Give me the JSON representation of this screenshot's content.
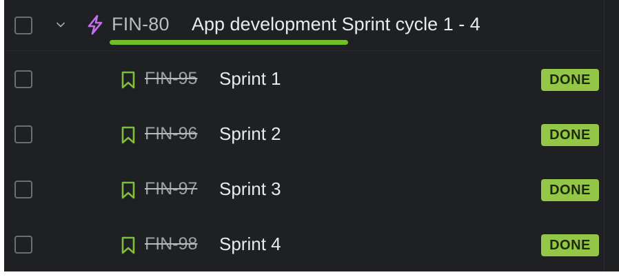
{
  "colors": {
    "background": "#1e1f21",
    "selected_row": "#1a2a45",
    "epic_icon": "#c370f0",
    "story_icon": "#7fbf3a",
    "progress": "#70bf28",
    "done_badge": "#94c748"
  },
  "parent": {
    "icon": "lightning-bolt-icon",
    "key": "FIN-80",
    "title": "App development Sprint cycle 1 - 4",
    "progress_done_fraction": 1.0
  },
  "children": [
    {
      "key": "FIN-95",
      "title": "Sprint 1",
      "status": "DONE",
      "icon": "bookmark-icon",
      "selected": true
    },
    {
      "key": "FIN-96",
      "title": "Sprint 2",
      "status": "DONE",
      "icon": "bookmark-icon",
      "selected": false
    },
    {
      "key": "FIN-97",
      "title": "Sprint 3",
      "status": "DONE",
      "icon": "bookmark-icon",
      "selected": false
    },
    {
      "key": "FIN-98",
      "title": "Sprint 4",
      "status": "DONE",
      "icon": "bookmark-icon",
      "selected": false
    }
  ]
}
